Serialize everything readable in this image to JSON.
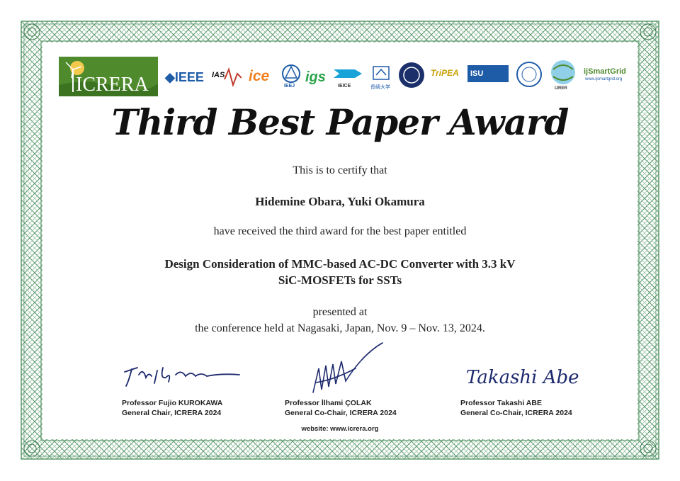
{
  "colors": {
    "border_green": "#5e9a6e",
    "crera_green": "#4f8a2c",
    "ieee_blue": "#1f5ca8",
    "ice_orange": "#f08020",
    "text": "#222222"
  },
  "logos": {
    "crera": "ICRERA",
    "ieee": "IEEE",
    "ias": "IAS",
    "ice": "ice",
    "igs": "igs",
    "ieej": "IEEJ",
    "ieice": "IEICE",
    "nagasaki": "長崎大学",
    "tripea": "TriPEA",
    "isu": "ISU",
    "ijsmartgrid": "ijSmartGrid",
    "ijsmartgrid_url": "www.ijsmartgrid.org",
    "ijrer": "IJRER"
  },
  "certificate": {
    "title": "Third Best Paper Award",
    "certify_line": "This is to certify that",
    "authors": "Hidemine Obara, Yuki Okamura",
    "received_line": "have received the third award for the best paper entitled",
    "paper_title_1": "Design Consideration of MMC-based AC-DC Converter with 3.3 kV",
    "paper_title_2": "SiC-MOSFETs for SSTs",
    "presented_line": "presented at",
    "conference_line": "the conference held at Nagasaki, Japan, Nov. 9 – Nov. 13, 2024."
  },
  "signatures": [
    {
      "name": "Professor Fujio KUROKAWA",
      "role": "General Chair, ICRERA 2024"
    },
    {
      "name": "Professor İlhami ÇOLAK",
      "role": "General Co-Chair, ICRERA 2024"
    },
    {
      "name": "Professor Takashi ABE",
      "role": "General Co-Chair, ICRERA 2024",
      "signature_text": "Takashi Abe"
    }
  ],
  "website": "website: www.icrera.org"
}
